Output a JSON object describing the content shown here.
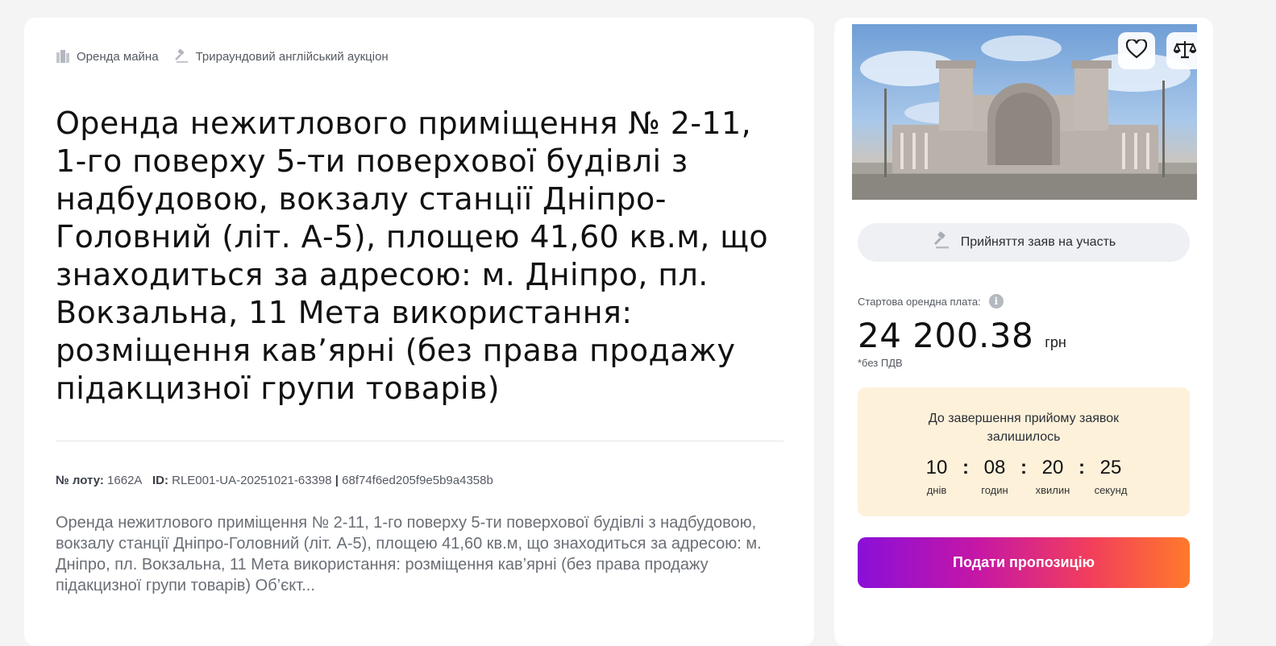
{
  "tags": {
    "property_rent": "Оренда майна",
    "auction_type": "Трираундовий англійський аукціон"
  },
  "title": "Оренда нежитлового приміщення № 2-11, 1-го поверху 5-ти поверхової будівлі з надбудовою, вокзалу станції Дніпро-Головний (літ. А-5), площею 41,60 кв.м, що знаходиться за адресою: м. Дніпро, пл. Вокзальна, 11 Мета використання: розміщення кав’ярні (без права продажу підакцизної групи товарів)",
  "lot": {
    "lot_label": "№ лоту:",
    "lot_value": "1662А",
    "id_label": "ID:",
    "id_value": "RLE001-UA-20251021-63398",
    "separator": "|",
    "hash": "68f74f6ed205f9e5b9a4358b"
  },
  "description": "Оренда нежитлового приміщення № 2-11, 1-го поверху 5-ти поверхової будівлі з надбудовою, вокзалу станції Дніпро-Головний (літ. А-5), площею 41,60 кв.м, що знаходиться за адресою: м. Дніпро, пл. Вокзальна, 11 Мета використання: розміщення кав’ярні (без права продажу підакцизної групи товарів) Об’єкт...",
  "sidebar": {
    "status": "Прийняття заяв на участь",
    "price_label": "Стартова орендна плата:",
    "price_value": "24 200.38",
    "price_currency": "грн",
    "vat_note": "*без ПДВ",
    "timer": {
      "title": "До завершення прийому заявок залишилось",
      "days": "10",
      "days_label": "днів",
      "hours": "08",
      "hours_label": "годин",
      "minutes": "20",
      "minutes_label": "хвилин",
      "seconds": "25",
      "seconds_label": "секунд",
      "separator": ":"
    },
    "submit_label": "Подати пропозицію"
  },
  "icons": {
    "property": "building-icon",
    "auction": "gavel-icon",
    "favorite": "heart-icon",
    "compare": "scales-icon",
    "info": "info-icon"
  },
  "colors": {
    "timer_bg": "#fdf1da",
    "status_bg": "#eef0f4",
    "cta_gradient_start": "#8a0fd8",
    "cta_gradient_end": "#ff7a2a"
  }
}
